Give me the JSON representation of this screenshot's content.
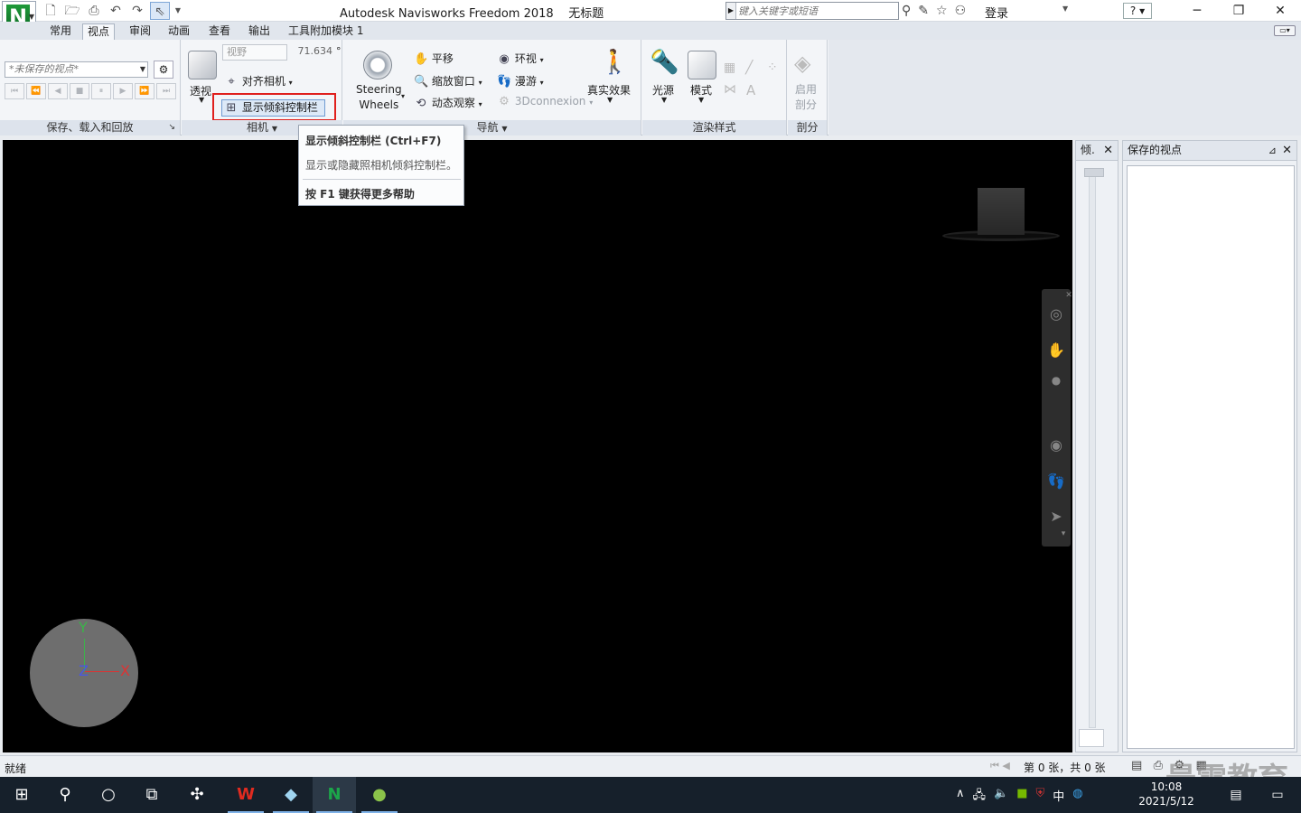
{
  "window": {
    "app_title": "Autodesk Navisworks Freedom 2018",
    "doc_title": "无标题",
    "search_placeholder": "键入关键字或短语",
    "login": "登录",
    "help": "?"
  },
  "tabs": [
    "常用",
    "视点",
    "审阅",
    "动画",
    "查看",
    "输出",
    "工具附加模块 1"
  ],
  "active_tab": "视点",
  "ribbon": {
    "save_panel": {
      "viewpoint_combo": "*未保存的视点*",
      "title": "保存、载入和回放"
    },
    "camera_panel": {
      "perspective": "透视",
      "fov_label": "视野",
      "fov_value": "71.634",
      "fov_unit": "°",
      "align_camera": "对齐相机",
      "show_tilt_bar": "显示倾斜控制栏",
      "title": "相机"
    },
    "nav_panel": {
      "steering_1": "Steering",
      "steering_2": "Wheels",
      "pan": "平移",
      "zoom_window": "缩放窗口",
      "orbit": "动态观察",
      "look_around": "环视",
      "walk": "漫游",
      "connexion": "3Dconnexion",
      "realism": "真实效果",
      "title": "导航"
    },
    "render_panel": {
      "lighting": "光源",
      "mode": "模式",
      "title": "渲染样式"
    },
    "section_panel": {
      "enable_1": "启用",
      "enable_2": "剖分",
      "title": "剖分"
    }
  },
  "tooltip": {
    "title": "显示倾斜控制栏 (Ctrl+F7)",
    "description": "显示或隐藏照相机倾斜控制栏。",
    "help": "按 F1 键获得更多帮助"
  },
  "panels": {
    "tilt_title": "倾.",
    "saved_views_title": "保存的视点"
  },
  "axis": {
    "x": "X",
    "y": "Y",
    "z": "Z"
  },
  "status": {
    "left": "就绪",
    "page": "第 0 张，共 0 张"
  },
  "watermark": "最需教育",
  "taskbar": {
    "time": "10:08",
    "date": "2021/5/12",
    "ime": "中"
  }
}
